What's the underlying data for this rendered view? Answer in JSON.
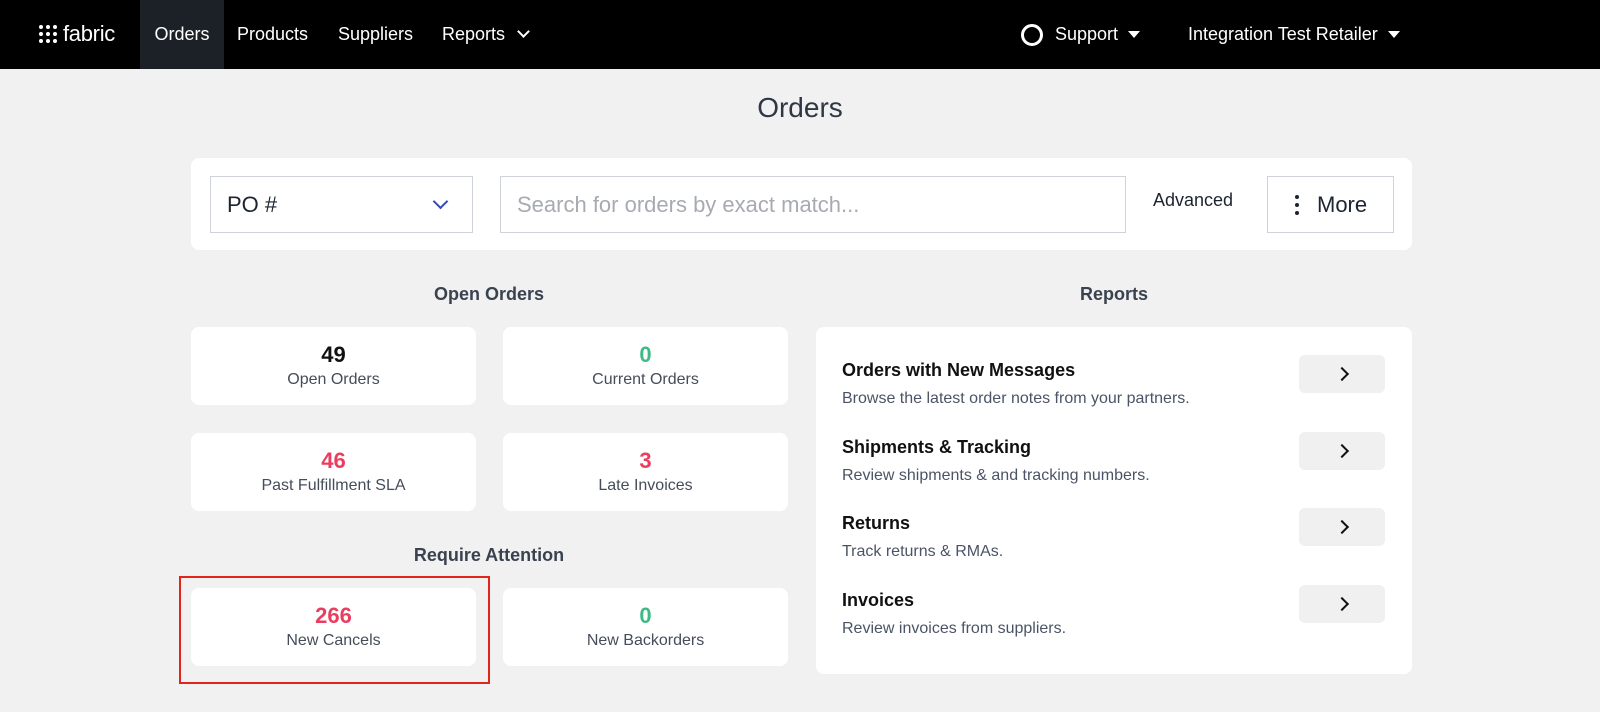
{
  "nav": {
    "logo_text": "fabric",
    "items": [
      {
        "label": "Orders"
      },
      {
        "label": "Products"
      },
      {
        "label": "Suppliers"
      },
      {
        "label": "Reports"
      }
    ],
    "support_label": "Support",
    "account_label": "Integration Test Retailer"
  },
  "page": {
    "title": "Orders"
  },
  "search": {
    "field_value": "PO #",
    "placeholder": "Search for orders by exact match...",
    "advanced_label": "Advanced",
    "more_label": "More"
  },
  "open_orders": {
    "heading": "Open Orders",
    "cards": [
      {
        "value": "49",
        "label": "Open Orders"
      },
      {
        "value": "0",
        "label": "Current Orders"
      },
      {
        "value": "46",
        "label": "Past Fulfillment SLA"
      },
      {
        "value": "3",
        "label": "Late Invoices"
      }
    ]
  },
  "require_attention": {
    "heading": "Require Attention",
    "cards": [
      {
        "value": "266",
        "label": "New Cancels"
      },
      {
        "value": "0",
        "label": "New Backorders"
      }
    ]
  },
  "reports": {
    "heading": "Reports",
    "items": [
      {
        "title": "Orders with New Messages",
        "description": "Browse the latest order notes from your partners."
      },
      {
        "title": "Shipments & Tracking",
        "description": "Review shipments & and tracking numbers."
      },
      {
        "title": "Returns",
        "description": "Track returns & RMAs."
      },
      {
        "title": "Invoices",
        "description": "Review invoices from suppliers."
      }
    ]
  },
  "colors": {
    "nav_bg": "#000000",
    "positive": "#3ebb84",
    "alert": "#ea3e61",
    "highlight": "#e1251b"
  }
}
